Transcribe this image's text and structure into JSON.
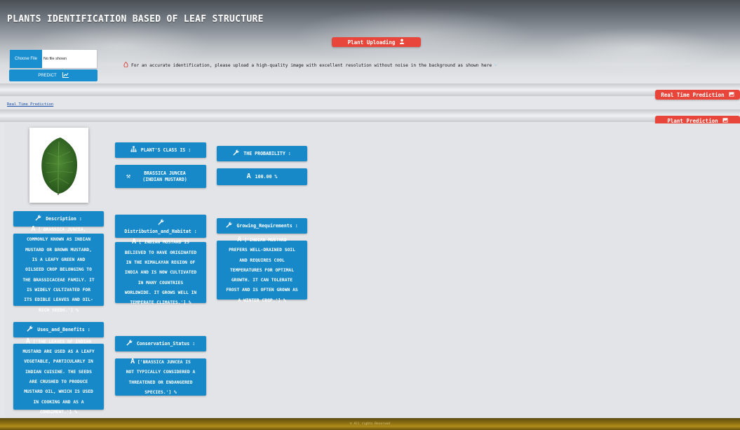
{
  "header": {
    "title": "PLANTS IDENTIFICATION BASED OF LEAF STRUCTURE"
  },
  "upload": {
    "section_button": "Plant Uploading",
    "choose_file": "Choose File",
    "no_file": "No file shown",
    "predict": "PREDICT",
    "notice": "For an accurate identification, please upload a high-quality image with excellent resolution without noise in the background as shown here"
  },
  "realtime": {
    "section_button": "Real Time Prediction",
    "link": "Real Time Prediction"
  },
  "prediction": {
    "section_button": "Plant Prediction",
    "class_label": "PLANT'S CLASS IS :",
    "class_value": "BRASSICA JUNCEA (INDIAN MUSTARD)",
    "probability_label": "THE PROBABILITY :",
    "probability_value": "100.00 %",
    "description_label": "Description :",
    "description_lines": [
      "['BRASSICA JUNCEA,",
      "COMMONLY KNOWN AS INDIAN",
      "MUSTARD OR BROWN MUSTARD,",
      "IS A LEAFY GREEN AND",
      "OILSEED CROP BELONGING TO",
      "THE BRASSICACEAE FAMILY. IT",
      "IS WIDELY CULTIVATED FOR",
      "ITS EDIBLE LEAVES AND OIL-",
      "RICH SEEDS.'] %"
    ],
    "distribution_label": "Distribution_and_Habitat :",
    "distribution_lines": [
      "['INDIAN MUSTARD IS",
      "BELIEVED TO HAVE ORIGINATED",
      "IN THE HIMALAYAN REGION OF",
      "INDIA AND IS NOW CULTIVATED",
      "IN MANY COUNTRIES",
      "WORLDWIDE. IT GROWS WELL IN",
      "TEMPERATE CLIMATES.'] %"
    ],
    "growing_label": "Growing_Requirements :",
    "growing_lines": [
      "['INDIAN MUSTARD",
      "PREFERS WELL-DRAINED SOIL",
      "AND REQUIRES COOL",
      "TEMPERATURES FOR OPTIMAL",
      "GROWTH. IT CAN TOLERATE",
      "FROST AND IS OFTEN GROWN AS",
      "A WINTER CROP.'] %"
    ],
    "uses_label": "Uses_and_Benefits :",
    "uses_lines": [
      "['THE LEAVES OF INDIAN",
      "MUSTARD ARE USED AS A LEAFY",
      "VEGETABLE, PARTICULARLY IN",
      "INDIAN CUISINE. THE SEEDS",
      "ARE CRUSHED TO PRODUCE",
      "MUSTARD OIL, WHICH IS USED",
      "IN COOKING AND AS A",
      "CONDIMENT.'] %"
    ],
    "conservation_label": "Conservation_Status :",
    "conservation_lines": [
      "['BRASSICA JUNCEA IS",
      "NOT TYPICALLY CONSIDERED A",
      "THREATENED OR ENDANGERED",
      "SPECIES.'] %"
    ]
  },
  "footer": {
    "text": "© All rights Reserved"
  },
  "colors": {
    "accent_blue": "#1789c8",
    "accent_red": "#e8463a",
    "footer_gold": "#b08d1a"
  },
  "icons": {
    "user": "user-icon",
    "chart": "chart-icon",
    "info": "info-icon",
    "wrench": "wrench-icon",
    "sitemap": "sitemap-icon",
    "font": "font-icon",
    "image": "image-icon",
    "hand_point": "hand-point-icon"
  }
}
